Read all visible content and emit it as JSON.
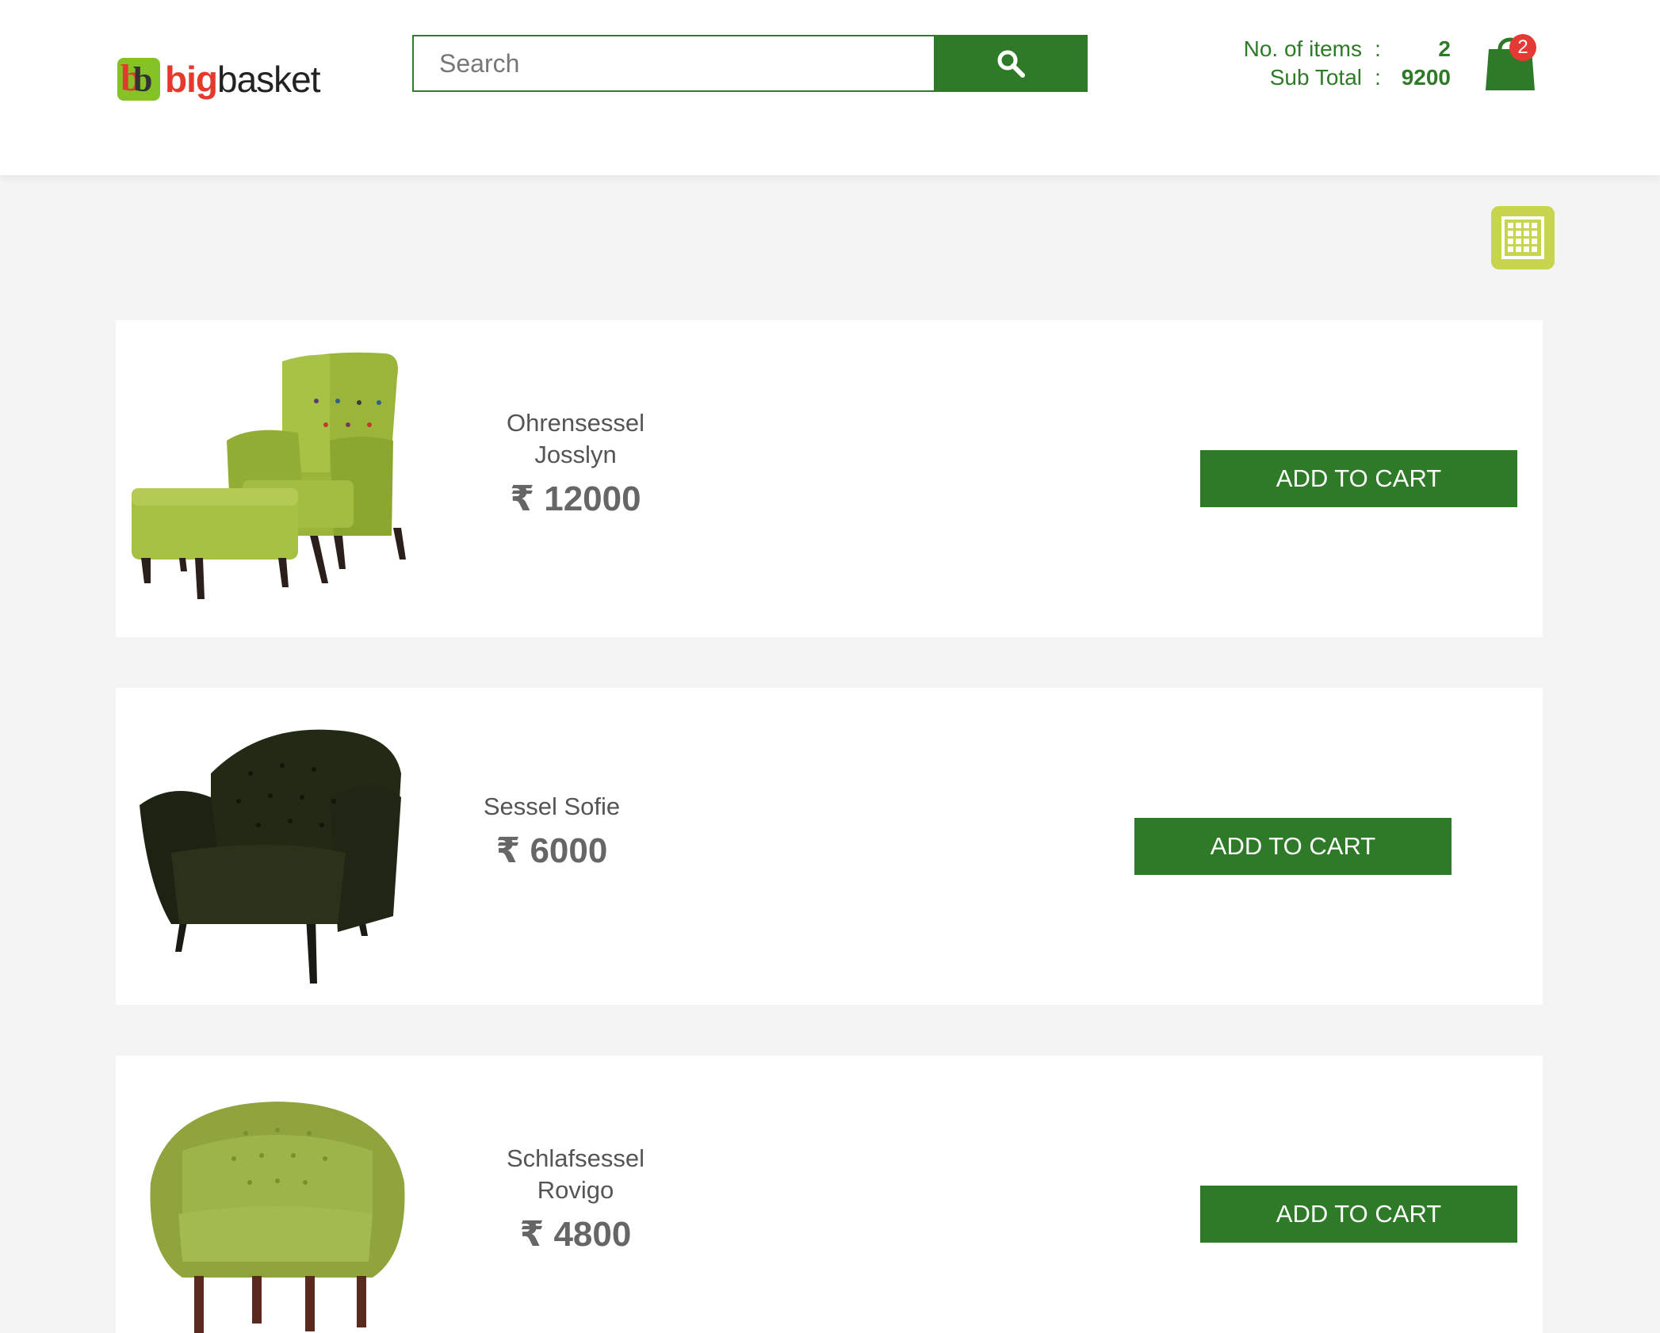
{
  "header": {
    "logo": {
      "big": "big",
      "basket": "basket"
    },
    "search": {
      "placeholder": "Search"
    },
    "cart": {
      "items_label": "No. of items",
      "items_value": "2",
      "subtotal_label": "Sub Total",
      "subtotal_value": "9200",
      "colon": ":",
      "badge": "2"
    }
  },
  "icons": {
    "search": "search-icon",
    "cart": "shopping-bag-icon",
    "view_toggle": "grid-view-icon"
  },
  "colors": {
    "primary_green": "#2f7a28",
    "accent_lime": "#c6d44e",
    "badge_red": "#e53935",
    "logo_red": "#e53a2b",
    "background": "#f4f4f4"
  },
  "products": [
    {
      "name_line1": "Ohrensessel",
      "name_line2": "Josslyn",
      "price": "₹ 12000",
      "button": "ADD TO CART"
    },
    {
      "name_line1": "Sessel Sofie",
      "name_line2": "",
      "price": "₹ 6000",
      "button": "ADD TO CART"
    },
    {
      "name_line1": "Schlafsessel",
      "name_line2": "Rovigo",
      "price": "₹ 4800",
      "button": "ADD TO CART"
    }
  ]
}
